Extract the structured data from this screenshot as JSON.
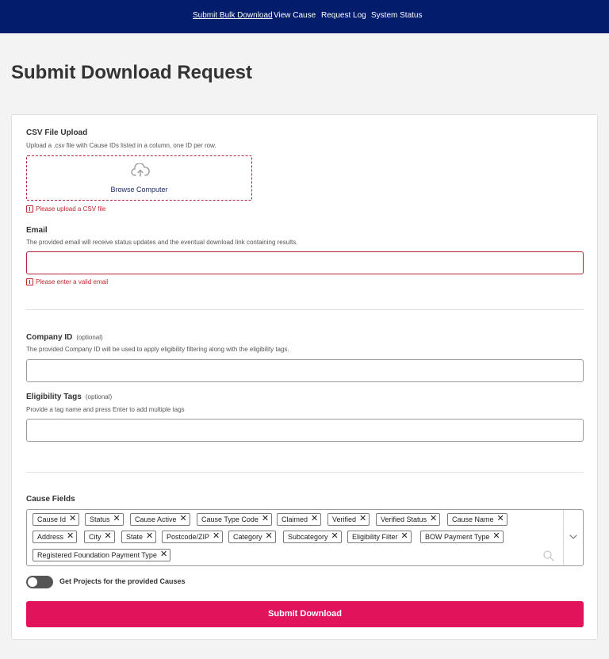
{
  "nav": {
    "items": [
      {
        "label": "Submit Bulk Download",
        "active": true
      },
      {
        "label": "View Cause"
      },
      {
        "label": "Request Log"
      },
      {
        "label": "System Status"
      }
    ]
  },
  "page_title": "Submit Download Request",
  "csv_upload": {
    "label": "CSV File Upload",
    "help": "Upload a .csv file with Cause IDs listed in a column, one ID per row.",
    "button": "Browse Computer",
    "error": "Please upload a CSV file",
    "icon": "cloud-upload-icon"
  },
  "email": {
    "label": "Email",
    "help": "The provided email will receive status updates and the eventual download link containing results.",
    "value": "",
    "error": "Please enter a valid email"
  },
  "company_id": {
    "label": "Company ID",
    "optional": "(optional)",
    "help": "The provided Company ID will be used to apply eligibility filtering along with the eligibility tags.",
    "value": ""
  },
  "eligibility_tags": {
    "label": "Eligibility Tags",
    "optional": "(optional)",
    "help": "Provide a tag name and press Enter to add multiple tags",
    "value": ""
  },
  "cause_fields": {
    "label": "Cause Fields",
    "chips": [
      "Cause Id",
      "Status",
      "Cause Active",
      "Cause Type Code",
      "Claimed",
      "Verified",
      "Verified Status",
      "Cause Name",
      "Address",
      "City",
      "State",
      "Postcode/ZIP",
      "Category",
      "Subcategory",
      "Eligibility Filter",
      "BOW Payment Type",
      "Registered Foundation Payment Type"
    ],
    "remove_glyph": "✕"
  },
  "projects_toggle": {
    "label": "Get Projects for the provided Causes",
    "on": false
  },
  "submit_label": "Submit Download",
  "colors": {
    "nav_bg": "#031c6b",
    "accent": "#e0135b",
    "error": "#c0262d",
    "page_bg": "#f3f3f3"
  }
}
